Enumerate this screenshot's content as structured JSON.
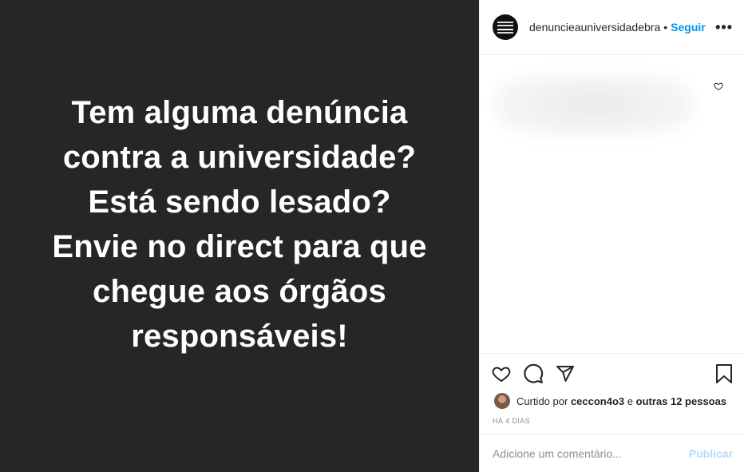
{
  "post": {
    "text_lines": [
      "Tem alguma denúncia",
      "contra a universidade?",
      "Está sendo lesado?",
      "Envie no direct para que",
      "chegue aos órgãos",
      "responsáveis!"
    ],
    "background": "#262626"
  },
  "header": {
    "username": "denuncieauniversidadebra",
    "separator": "•",
    "follow_label": "Seguir",
    "more_label": "•••"
  },
  "actions": {
    "icons": [
      "heart-icon",
      "comment-icon",
      "share-icon",
      "bookmark-icon"
    ]
  },
  "likes": {
    "prefix": "Curtido por",
    "user": "ceccon4o3",
    "connector": "e",
    "others": "outras 12 pessoas"
  },
  "timestamp": "HÁ 4 DIAS",
  "comment_box": {
    "placeholder": "Adicione um comentário...",
    "publish_label": "Publicar"
  },
  "colors": {
    "accent": "#0095f6",
    "publish_disabled": "#b3dbff",
    "muted": "#8e8e8e"
  }
}
